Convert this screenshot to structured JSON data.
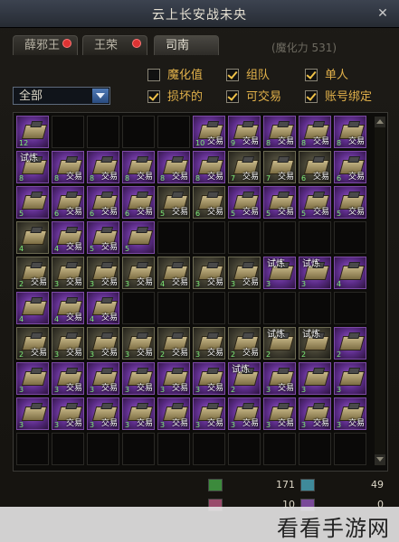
{
  "window": {
    "title": "云上长安战未央"
  },
  "tabs": [
    {
      "label": "薛邪王",
      "alert": true,
      "active": false
    },
    {
      "label": "王荣",
      "alert": true,
      "active": false
    },
    {
      "label": "司南",
      "alert": false,
      "active": true
    }
  ],
  "magic_power": "(魔化力 531)",
  "filters": [
    {
      "label": "魔化值",
      "checked": false
    },
    {
      "label": "组队",
      "checked": true
    },
    {
      "label": "单人",
      "checked": true
    },
    {
      "label": "损坏的",
      "checked": true
    },
    {
      "label": "可交易",
      "checked": true
    },
    {
      "label": "账号绑定",
      "checked": true
    }
  ],
  "category_select": {
    "value": "全部"
  },
  "inventory": {
    "columns": 10,
    "rows": [
      [
        {
          "n": "12",
          "t": false,
          "trial": false,
          "style": "item"
        },
        {
          "empty": true
        },
        {
          "empty": true
        },
        {
          "empty": true
        },
        {
          "empty": true
        },
        {
          "n": "10",
          "t": true,
          "style": "item"
        },
        {
          "n": "9",
          "t": true,
          "style": "item"
        },
        {
          "n": "8",
          "t": true,
          "style": "item"
        },
        {
          "n": "8",
          "t": true,
          "style": "item"
        },
        {
          "n": "8",
          "t": true,
          "style": "item"
        }
      ],
      [
        {
          "n": "8",
          "t": false,
          "trial": true,
          "style": "item"
        },
        {
          "n": "8",
          "t": true,
          "style": "item"
        },
        {
          "n": "8",
          "t": true,
          "style": "item"
        },
        {
          "n": "8",
          "t": true,
          "style": "item"
        },
        {
          "n": "8",
          "t": true,
          "style": "item"
        },
        {
          "n": "8",
          "t": true,
          "style": "item"
        },
        {
          "n": "7",
          "t": true,
          "style": "gold"
        },
        {
          "n": "7",
          "t": true,
          "style": "gold"
        },
        {
          "n": "6",
          "t": true,
          "style": "gold"
        },
        {
          "n": "6",
          "t": true,
          "style": "item"
        }
      ],
      [
        {
          "n": "5",
          "t": false,
          "style": "item"
        },
        {
          "n": "6",
          "t": true,
          "style": "item"
        },
        {
          "n": "6",
          "t": true,
          "style": "item"
        },
        {
          "n": "6",
          "t": true,
          "style": "item"
        },
        {
          "n": "5",
          "t": true,
          "style": "gold"
        },
        {
          "n": "6",
          "t": true,
          "style": "gold"
        },
        {
          "n": "5",
          "t": true,
          "style": "item"
        },
        {
          "n": "5",
          "t": true,
          "style": "item"
        },
        {
          "n": "5",
          "t": true,
          "style": "item"
        },
        {
          "n": "5",
          "t": true,
          "style": "item"
        }
      ],
      [
        {
          "n": "4",
          "t": false,
          "style": "gold"
        },
        {
          "n": "4",
          "t": true,
          "style": "item"
        },
        {
          "n": "5",
          "t": true,
          "style": "item"
        },
        {
          "n": "5",
          "t": false,
          "style": "item"
        },
        {
          "empty": true
        },
        {
          "empty": true
        },
        {
          "empty": true
        },
        {
          "empty": true
        },
        {
          "empty": true
        },
        {
          "empty": true
        }
      ],
      [
        {
          "n": "2",
          "t": true,
          "style": "gold"
        },
        {
          "n": "3",
          "t": true,
          "style": "gold"
        },
        {
          "n": "3",
          "t": true,
          "style": "gold"
        },
        {
          "n": "3",
          "t": true,
          "style": "gold"
        },
        {
          "n": "4",
          "t": true,
          "style": "gold"
        },
        {
          "n": "3",
          "t": true,
          "style": "gold"
        },
        {
          "n": "3",
          "t": true,
          "style": "gold"
        },
        {
          "n": "3",
          "t": false,
          "trial": true,
          "style": "item"
        },
        {
          "n": "3",
          "t": false,
          "trial": true,
          "style": "item"
        },
        {
          "n": "4",
          "t": false,
          "style": "item"
        }
      ],
      [
        {
          "n": "4",
          "t": false,
          "style": "item"
        },
        {
          "n": "4",
          "t": true,
          "style": "item"
        },
        {
          "n": "4",
          "t": true,
          "style": "item"
        },
        {
          "empty": true
        },
        {
          "empty": true
        },
        {
          "empty": true
        },
        {
          "empty": true
        },
        {
          "empty": true
        },
        {
          "empty": true
        },
        {
          "empty": true
        }
      ],
      [
        {
          "n": "2",
          "t": true,
          "style": "gold"
        },
        {
          "n": "3",
          "t": true,
          "style": "gold"
        },
        {
          "n": "3",
          "t": true,
          "style": "gold"
        },
        {
          "n": "3",
          "t": true,
          "style": "gold"
        },
        {
          "n": "2",
          "t": true,
          "style": "gold"
        },
        {
          "n": "3",
          "t": true,
          "style": "gold"
        },
        {
          "n": "2",
          "t": true,
          "style": "gold"
        },
        {
          "n": "2",
          "t": false,
          "trial": true,
          "style": "gold"
        },
        {
          "n": "2",
          "t": false,
          "trial": true,
          "style": "gold"
        },
        {
          "n": "2",
          "t": false,
          "style": "item"
        }
      ],
      [
        {
          "n": "3",
          "t": false,
          "style": "item"
        },
        {
          "n": "3",
          "t": true,
          "style": "item"
        },
        {
          "n": "3",
          "t": true,
          "style": "item"
        },
        {
          "n": "3",
          "t": true,
          "style": "item"
        },
        {
          "n": "3",
          "t": true,
          "style": "item"
        },
        {
          "n": "3",
          "t": true,
          "style": "item"
        },
        {
          "n": "2",
          "t": false,
          "trial": true,
          "style": "item"
        },
        {
          "n": "3",
          "t": true,
          "style": "item"
        },
        {
          "n": "3",
          "t": false,
          "style": "item"
        },
        {
          "n": "3",
          "t": false,
          "style": "item"
        }
      ],
      [
        {
          "n": "3",
          "t": false,
          "style": "item"
        },
        {
          "n": "3",
          "t": true,
          "style": "item"
        },
        {
          "n": "3",
          "t": true,
          "style": "item"
        },
        {
          "n": "3",
          "t": true,
          "style": "item"
        },
        {
          "n": "3",
          "t": true,
          "style": "item"
        },
        {
          "n": "3",
          "t": true,
          "style": "item"
        },
        {
          "n": "3",
          "t": true,
          "style": "item"
        },
        {
          "n": "3",
          "t": true,
          "style": "item"
        },
        {
          "n": "3",
          "t": true,
          "style": "item"
        },
        {
          "n": "3",
          "t": true,
          "style": "item"
        }
      ],
      [
        {
          "empty": true
        },
        {
          "empty": true
        },
        {
          "empty": true
        },
        {
          "empty": true
        },
        {
          "empty": true
        },
        {
          "empty": true
        },
        {
          "empty": true
        },
        {
          "empty": true
        },
        {
          "empty": true
        },
        {
          "empty": true
        }
      ]
    ]
  },
  "labels": {
    "trade": "交易",
    "trial": "试炼"
  },
  "currencies": [
    {
      "icon": "green-gem-icon",
      "value": "171"
    },
    {
      "icon": "teal-gem-icon",
      "value": "49"
    },
    {
      "icon": "pink-gem-icon",
      "value": "10"
    },
    {
      "icon": "purple-gem-icon",
      "value": "0"
    }
  ],
  "watermark": "看看手游网"
}
